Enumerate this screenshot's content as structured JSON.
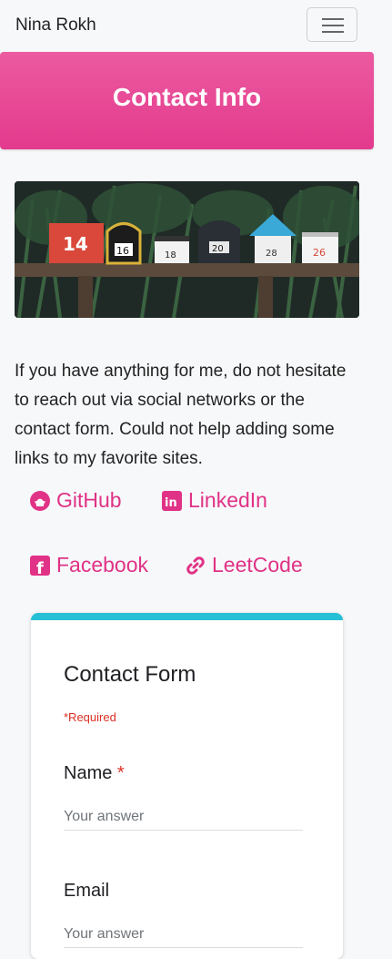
{
  "navbar": {
    "brand": "Nina Rokh",
    "menu_icon": "hamburger-icon"
  },
  "hero": {
    "title": "Contact Info"
  },
  "image": {
    "subject": "mailboxes",
    "numbers": [
      "14",
      "16",
      "18",
      "20",
      "28",
      "26"
    ]
  },
  "intro": {
    "text": "If you have anything for me, do not hesitate to reach out via social networks or the contact form. Could not help adding some links to my favorite sites."
  },
  "links": [
    {
      "label": "GitHub",
      "icon": "github-icon"
    },
    {
      "label": "LinkedIn",
      "icon": "linkedin-icon"
    },
    {
      "label": "Facebook",
      "icon": "facebook-icon"
    },
    {
      "label": "LeetCode",
      "icon": "link-icon"
    }
  ],
  "form": {
    "title": "Contact Form",
    "required_note": "*Required",
    "fields": [
      {
        "label": "Name",
        "required_mark": "*",
        "placeholder": "Your answer"
      },
      {
        "label": "Email",
        "placeholder": "Your answer"
      }
    ]
  },
  "colors": {
    "accent": "#e03286",
    "hero": "#e84896",
    "form_accent": "#26c0d6",
    "required": "#d93025"
  }
}
